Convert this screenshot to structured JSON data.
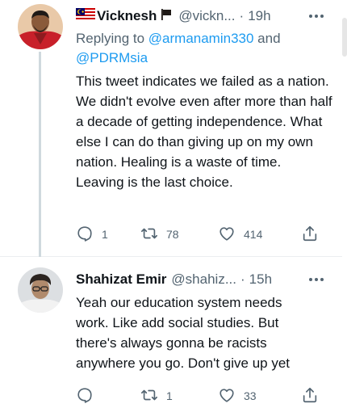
{
  "tweets": [
    {
      "author": {
        "name": "Vicknesh",
        "handle": "@vickn...",
        "avatar": "man-in-red-shirt"
      },
      "time": "19h",
      "reply_prefix": "Replying to ",
      "reply_to": [
        "@armanamin330",
        "@PDRMsia"
      ],
      "reply_join": " and ",
      "text": "This tweet indicates we failed as a nation. We didn't evolve even after more than half a decade of getting independence. What else I can do than giving up on my own nation. Healing is a waste of time. Leaving is the last choice.",
      "replies": "1",
      "retweets": "78",
      "likes": "414"
    },
    {
      "author": {
        "name": "Shahizat Emir",
        "handle": "@shahiz...",
        "avatar": "man-with-glasses"
      },
      "time": "15h",
      "text": "Yeah our education system needs work. Like add social studies. But there's always gonna be racists anywhere you go. Don't give up yet",
      "replies": "",
      "retweets": "1",
      "likes": "33"
    }
  ],
  "dot_separator": "·",
  "colors": {
    "text": "#0f1419",
    "muted": "#536471",
    "link": "#1d9bf0",
    "divider": "#ebeef0"
  }
}
